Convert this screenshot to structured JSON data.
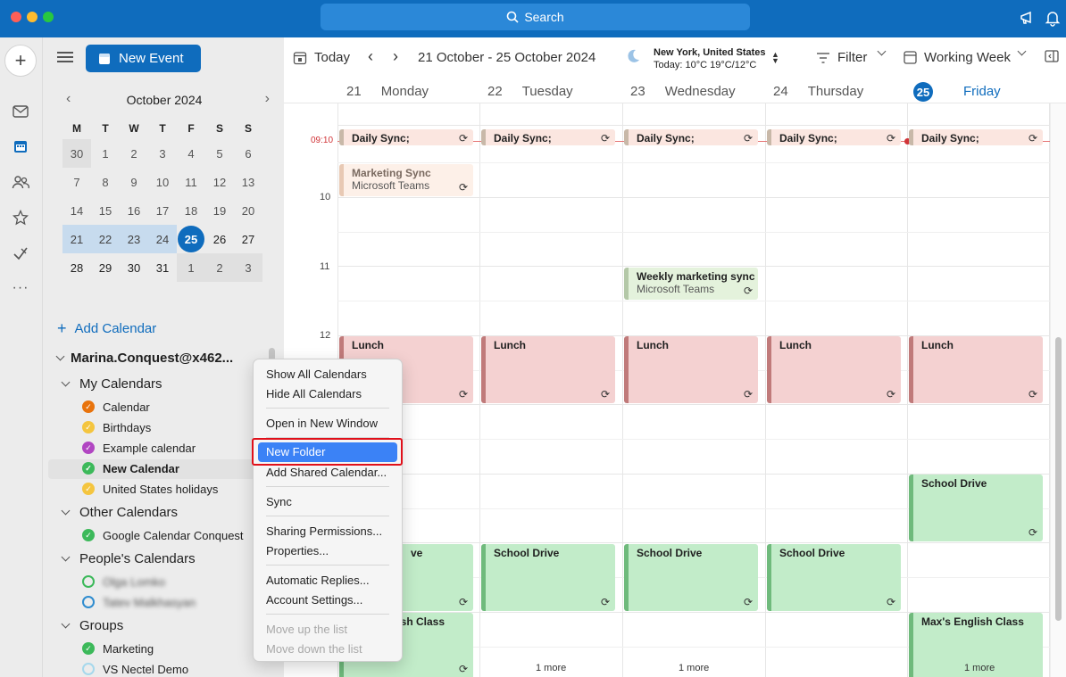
{
  "titlebar": {
    "search_label": "Search"
  },
  "sidebar": {
    "new_event_label": "New Event",
    "mini_calendar": {
      "month_label": "October 2024",
      "weekday_labels": [
        "M",
        "T",
        "W",
        "T",
        "F",
        "S",
        "S"
      ],
      "days": [
        [
          "30",
          "1",
          "2",
          "3",
          "4",
          "5",
          "6"
        ],
        [
          "7",
          "8",
          "9",
          "10",
          "11",
          "12",
          "13"
        ],
        [
          "14",
          "15",
          "16",
          "17",
          "18",
          "19",
          "20"
        ],
        [
          "21",
          "22",
          "23",
          "24",
          "25",
          "26",
          "27"
        ],
        [
          "28",
          "29",
          "30",
          "31",
          "1",
          "2",
          "3"
        ]
      ],
      "today": "25"
    },
    "add_calendar_label": "Add Calendar",
    "account_label": "Marina.Conquest@x462...",
    "groups": {
      "my_calendars": "My Calendars",
      "other_calendars": "Other Calendars",
      "peoples_calendars": "People's Calendars",
      "groups": "Groups"
    },
    "calendars": {
      "calendar": "Calendar",
      "birthdays": "Birthdays",
      "example": "Example calendar",
      "new_calendar": "New Calendar",
      "us_holidays": "United States holidays",
      "google": "Google Calendar Conquest",
      "person1": "Olga Lomko",
      "person2": "Tatev Malkhasyan",
      "marketing": "Marketing",
      "vs_nectel": "VS Nectel Demo"
    },
    "colors": {
      "orange": "#e8730c",
      "yellow": "#f4c53f",
      "purple": "#b146c2",
      "green": "#3cb95a",
      "blue": "#2f8ccf",
      "light_blue": "#a6d8ec"
    }
  },
  "toolbar": {
    "today_label": "Today",
    "date_range": "21 October - 25 October 2024",
    "weather_location": "New York, United States",
    "weather_detail": "Today: 10°C  19°C/12°C",
    "filter_label": "Filter",
    "view_label": "Working Week"
  },
  "days": [
    {
      "num": "21",
      "name": "Monday"
    },
    {
      "num": "22",
      "name": "Tuesday"
    },
    {
      "num": "23",
      "name": "Wednesday"
    },
    {
      "num": "24",
      "name": "Thursday"
    },
    {
      "num": "25",
      "name": "Friday"
    }
  ],
  "grid": {
    "now_label": "09:10",
    "hours": [
      "10",
      "11",
      "12"
    ],
    "more_label": "1 more"
  },
  "events": {
    "daily_sync": "Daily Sync;",
    "marketing_sync": "Marketing Sync",
    "teams": "Microsoft Teams",
    "weekly_marketing": "Weekly marketing sync",
    "lunch": "Lunch",
    "school_drive": "School Drive",
    "school_drive_partial": "ve",
    "english_class": "Max's English Class",
    "english_partial": "lish Class"
  },
  "context_menu": {
    "show_all": "Show All Calendars",
    "hide_all": "Hide All Calendars",
    "open_new_window": "Open in New Window",
    "new_folder": "New Folder",
    "add_shared": "Add Shared Calendar...",
    "sync": "Sync",
    "sharing": "Sharing Permissions...",
    "properties": "Properties...",
    "auto_replies": "Automatic Replies...",
    "account_settings": "Account Settings...",
    "move_up": "Move up the list",
    "move_down": "Move down the list"
  }
}
